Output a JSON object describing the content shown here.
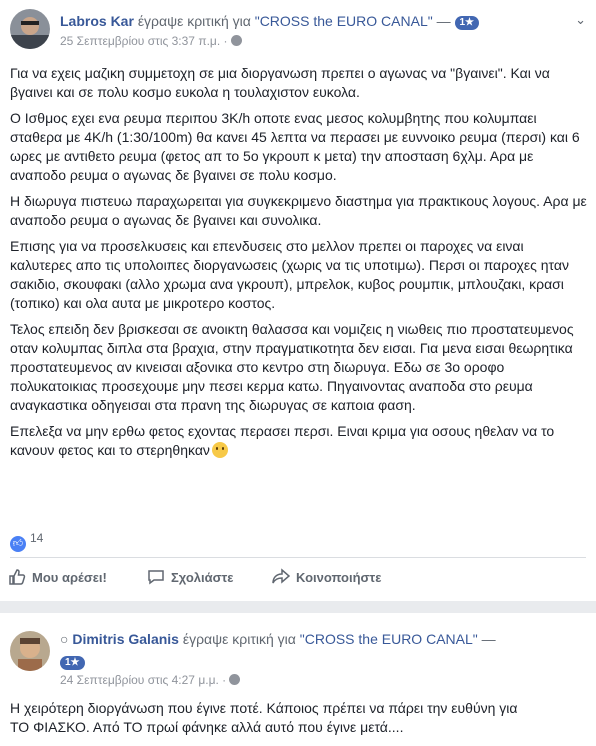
{
  "post1": {
    "author": "Labros Kar",
    "wrote_review_for": "έγραψε κριτική για",
    "page_name": "\"CROSS the EURO CANAL\"",
    "dash": "—",
    "badge": "1★",
    "timestamp": "25 Σεπτεμβρίου στις 3:37 π.μ. ·",
    "paragraphs": [
      "Για να εχεις μαζικη συμμετοχη σε μια διοργανωση πρεπει ο αγωνας να \"βγαινει\". Και να βγαινει και σε πολυ κοσμο ευκολα η τουλαχιστον ευκολα.",
      "Ο Ισθμος εχει ενα ρευμα περιπου 3K/h οποτε ενας μεσος κολυμβητης που κολυμπαει σταθερα με 4K/h (1:30/100m) θα κανει 45 λεπτα να περασει με ευννοικο ρευμα (περσι) και 6 ωρες με αντιθετο ρευμα (φετος απ το 5ο γκρουπ κ μετα) την αποσταση 6χλμ. Αρα με αναποδο ρευμα ο αγωνας δε βγαινει σε πολυ κοσμο.",
      "Η διωρυγα πιστευω παραχωρειται για συγκεκριμενο διαστημα για πρακτικους λογους. Αρα με αναποδο ρευμα ο αγωνας δε βγαινει και συνολικα.",
      "Επισης για να προσελκυσεις και επενδυσεις στο μελλον πρεπει οι παροχες να ειναι καλυτερες απο τις υπολοιπες διοργανωσεις (χωρις να τις υποτιμω). Περσι οι παροχες ηταν σακιδιο, σκουφακι (αλλο χρωμα ανα γκρουπ), μπρελοκ, κυβος ρουμπικ, μπλουζακι, κρασι (τοπικο) και ολα αυτα με μικροτερο κοστος.",
      "Τελος επειδη δεν βρισκεσαι σε ανοικτη θαλασσα και νομιζεις η νιωθεις πιο προστατευμενος οταν κολυμπας διπλα στα βραχια, στην πραγματικοτητα δεν εισαι. Για μενα εισαι θεωρητικα προστατευμενος αν κινεισαι αξονικα στο κεντρο στη διωρυγα. Εδω σε 3ο οροφο πολυκατοικιας προσεχουμε μην πεσει κερμα κατω. Πηγαινοντας αναποδα στο ρευμα αναγκαστικα οδηγεισαι στα πρανη της διωρυγας σε καποια φαση.",
      "Επελεξα να μην ερθω φετος εχοντας περασει περσι. Ειναι κριμα για οσους ηθελαν να το κανουν φετος και το στερηθηκαν"
    ],
    "like_count": "14",
    "actions": {
      "like": "Μου αρέσει!",
      "comment": "Σχολιάστε",
      "share": "Κοινοποιήστε"
    }
  },
  "post2": {
    "author": "Dimitris Galanis",
    "wrote_review_for": "έγραψε κριτική για",
    "page_name": "\"CROSS the EURO CANAL\"",
    "dash": "—",
    "badge": "1★",
    "timestamp": "24 Σεπτεμβρίου στις 4:27 μ.μ. ·",
    "text_line1": "Η χειρότερη διοργάνωση που έγινε ποτέ. Κάποιος πρέπει να πάρει την ευθύνη για",
    "text_line2": "ΤΟ ΦΙΑΣΚΟ. Από ΤΟ πρωί φάνηκε αλλά αυτό που έγινε μετά...."
  },
  "colors": {
    "link": "#385898",
    "badge": "#4267b2",
    "background": "#e9ebee"
  }
}
